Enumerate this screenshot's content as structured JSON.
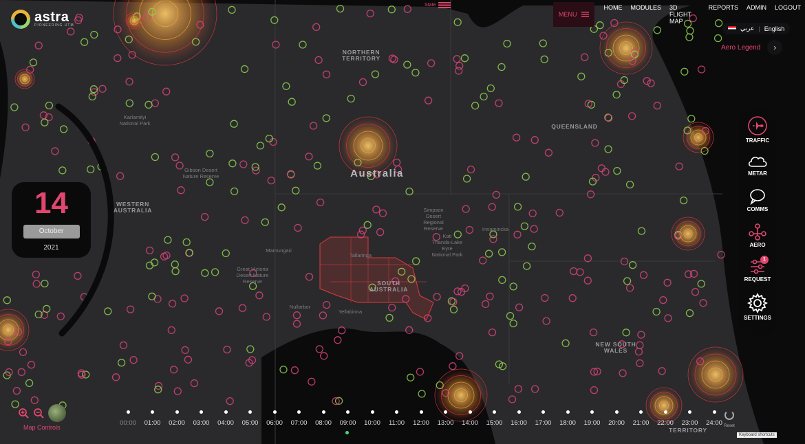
{
  "brand": {
    "name": "astra",
    "tagline": "PIONEERING UTM"
  },
  "state_label": "State",
  "nav": {
    "menu": "MENU",
    "links": [
      "HOME",
      "MODULES",
      "3D FLIGHT MAP",
      "REPORTS",
      "ADMIN",
      "LOGOUT"
    ]
  },
  "language": {
    "arabic": "عربي",
    "english": "English"
  },
  "aero_legend": "Aero Legend",
  "right_panel": [
    {
      "label": "TRAFFIC",
      "icon": "plane-icon",
      "active": true
    },
    {
      "label": "METAR",
      "icon": "cloud-icon",
      "active": false
    },
    {
      "label": "COMMS",
      "icon": "chat-icon",
      "active": false
    },
    {
      "label": "AERO",
      "icon": "network-icon",
      "active": true
    },
    {
      "label": "REQUEST",
      "icon": "sliders-icon",
      "active": true,
      "badge": "1"
    },
    {
      "label": "SETTINGS",
      "icon": "gear-icon",
      "active": false
    }
  ],
  "date": {
    "day": "14",
    "month": "October",
    "year": "2021"
  },
  "map_controls": "Map Controls",
  "map_labels": [
    {
      "text": "NORTHERN",
      "kind": "region"
    },
    {
      "text": "TERRITORY",
      "kind": "region"
    },
    {
      "text": "QUEENSLAND",
      "kind": "region"
    },
    {
      "text": "WESTERN",
      "kind": "region"
    },
    {
      "text": "AUSTRALIA",
      "kind": "region"
    },
    {
      "text": "SOUTH",
      "kind": "region"
    },
    {
      "text": "AUSTRALIA",
      "kind": "region"
    },
    {
      "text": "NEW SOUTH",
      "kind": "region"
    },
    {
      "text": "WALES",
      "kind": "region"
    },
    {
      "text": "TERRITORY",
      "kind": "region"
    },
    {
      "text": "Australia",
      "kind": "country"
    },
    {
      "text": "Karlamilyi",
      "kind": "park"
    },
    {
      "text": "National Park",
      "kind": "park"
    },
    {
      "text": "Gibson Desert",
      "kind": "park"
    },
    {
      "text": "Nature Reserve",
      "kind": "park"
    },
    {
      "text": "Simpson",
      "kind": "park"
    },
    {
      "text": "Desert",
      "kind": "park"
    },
    {
      "text": "Regional",
      "kind": "park"
    },
    {
      "text": "Reserve",
      "kind": "park"
    },
    {
      "text": "Kati",
      "kind": "park"
    },
    {
      "text": "Thanda-Lake",
      "kind": "park"
    },
    {
      "text": "Eyre",
      "kind": "park"
    },
    {
      "text": "National Park",
      "kind": "park"
    },
    {
      "text": "Mamungari",
      "kind": "place"
    },
    {
      "text": "Great Victoria",
      "kind": "park"
    },
    {
      "text": "Desert Nature",
      "kind": "park"
    },
    {
      "text": "Reserve",
      "kind": "park"
    },
    {
      "text": "Nullarbor",
      "kind": "place"
    },
    {
      "text": "Yellabinna",
      "kind": "place"
    },
    {
      "text": "Tallaringa",
      "kind": "place"
    },
    {
      "text": "Innamincka",
      "kind": "place"
    }
  ],
  "timeline": {
    "hours": [
      "00:00",
      "01:00",
      "02:00",
      "03:00",
      "04:00",
      "05:00",
      "06:00",
      "07:00",
      "08:00",
      "09:00",
      "10:00",
      "11:00",
      "12:00",
      "13:00",
      "14:00",
      "15:00",
      "16:00",
      "17:00",
      "18:00",
      "19:00",
      "20:00",
      "21:00",
      "22:00",
      "23:00",
      "24:00"
    ],
    "current": "09:00"
  },
  "reset_label": "Reset",
  "keyboard_shortcuts": "Keyboard shortcuts",
  "colors": {
    "accent": "#e0466e",
    "green": "#8fd14f",
    "orange": "#f2a93b",
    "red": "#e03a3a"
  }
}
